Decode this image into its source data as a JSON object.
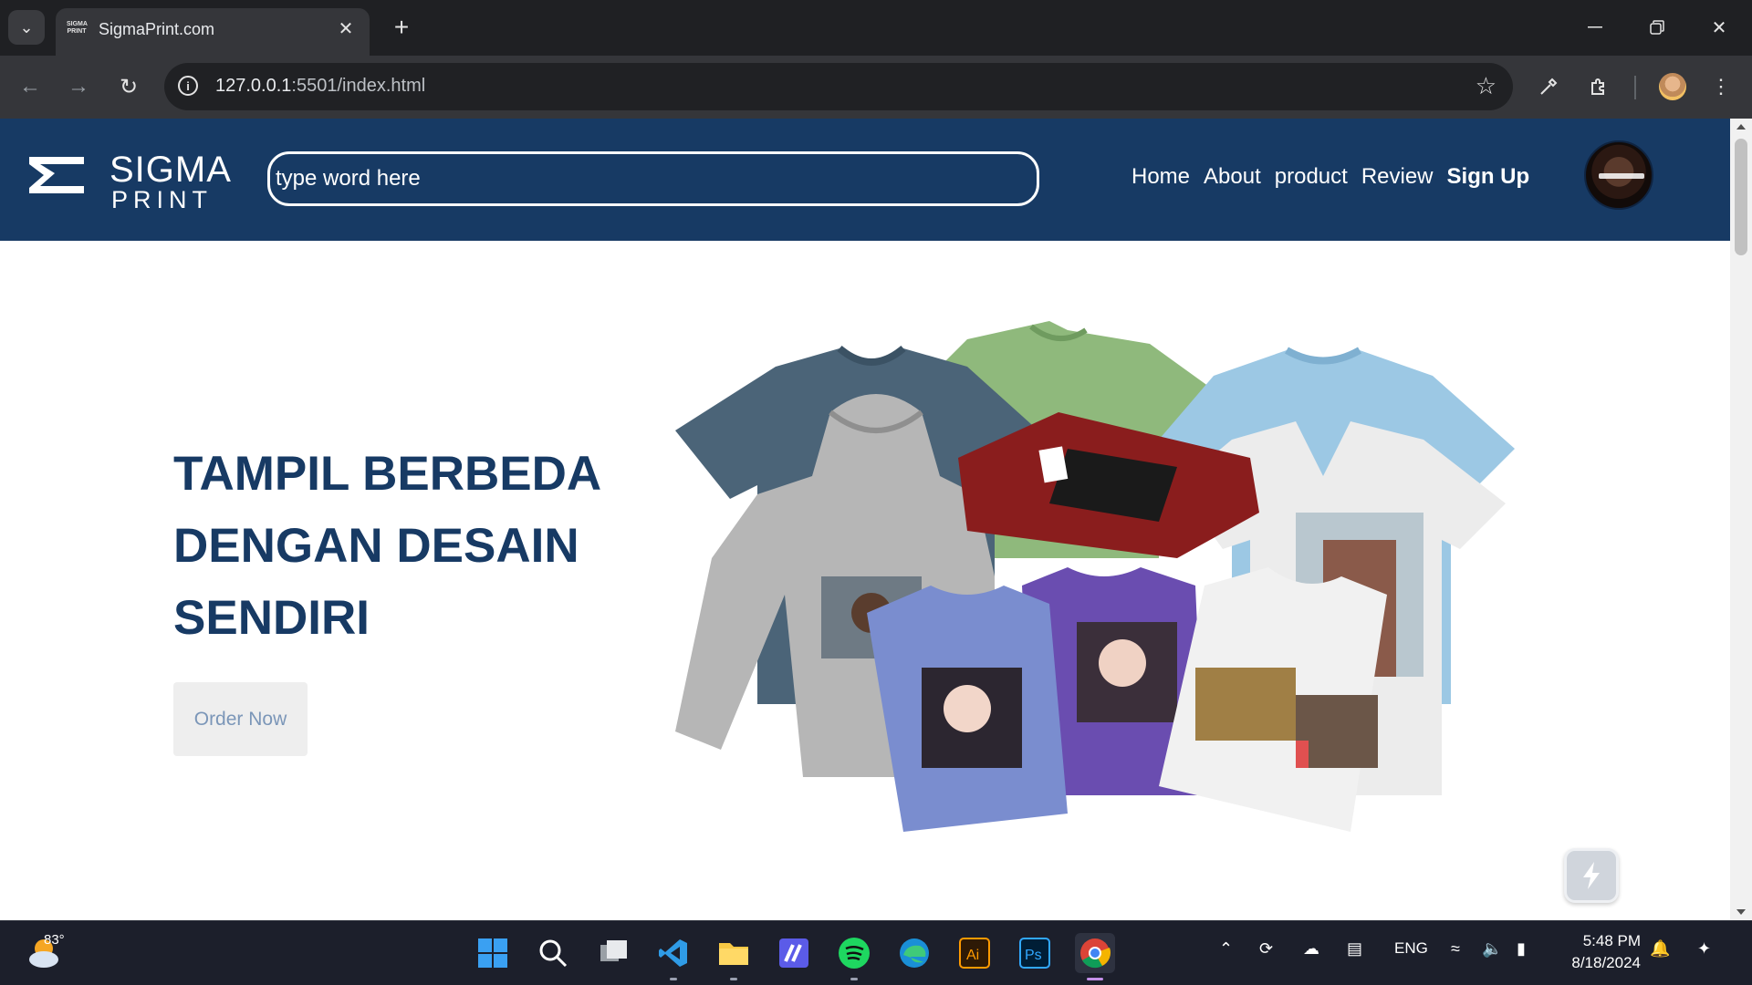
{
  "browser": {
    "tab": {
      "favicon_text": "SIGMA PRINT",
      "title": "SigmaPrint.com"
    },
    "url_host": "127.0.0.1",
    "url_rest": ":5501/index.html"
  },
  "site": {
    "logo": {
      "line1": "SIGMA",
      "line2": "PRINT"
    },
    "search": {
      "placeholder": "type word here"
    },
    "nav": [
      "Home",
      "About",
      "product",
      "Review",
      "Sign Up"
    ],
    "hero": {
      "title_lines": [
        "TAMPIL BERBEDA",
        "DENGAN DESAIN",
        "SENDIRI"
      ],
      "cta": "Order Now"
    }
  },
  "taskbar": {
    "weather_temp": "83°",
    "language": "ENG",
    "time": "5:48 PM",
    "date": "8/18/2024"
  },
  "colors": {
    "header_bg": "#173a64",
    "hero_text": "#173a64",
    "cta_bg": "#eeeeee",
    "cta_text": "#7b96b8"
  }
}
